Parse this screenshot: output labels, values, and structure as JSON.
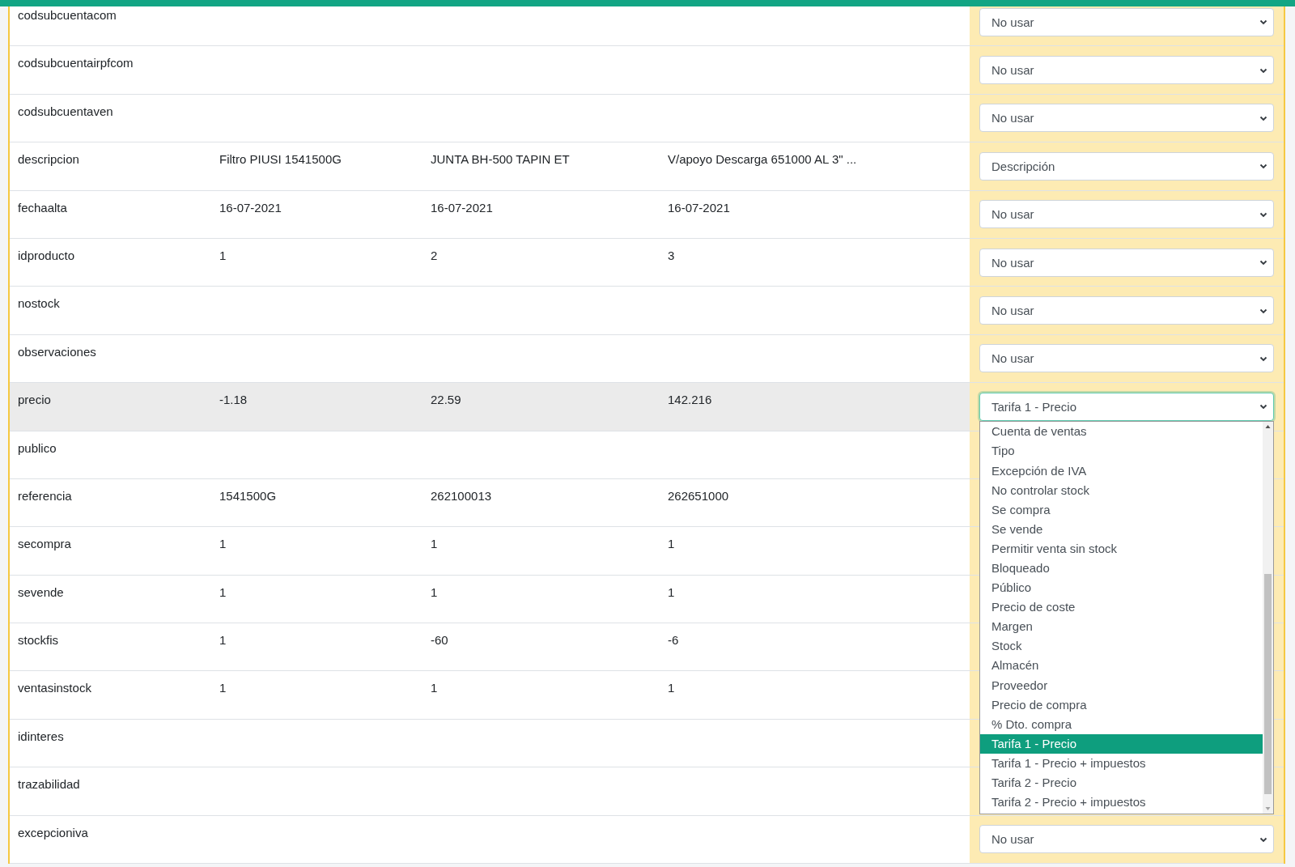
{
  "rows": [
    {
      "label": "codsubcuentacom",
      "highlighted": false,
      "mapping": {
        "value": "No usar",
        "focused": false
      }
    },
    {
      "label": "codsubcuentairpfcom",
      "highlighted": false,
      "mapping": {
        "value": "No usar",
        "focused": false
      }
    },
    {
      "label": "codsubcuentaven",
      "highlighted": false,
      "mapping": {
        "value": "No usar",
        "focused": false
      }
    },
    {
      "label": "descripcion",
      "highlighted": false,
      "values": [
        "Filtro PIUSI 1541500G",
        "JUNTA BH-500 TAPIN ET",
        "V/apoyo Descarga 651000 AL 3\" ..."
      ],
      "mapping": {
        "value": "Descripción",
        "focused": false
      }
    },
    {
      "label": "fechaalta",
      "highlighted": false,
      "values": [
        "16-07-2021",
        "16-07-2021",
        "16-07-2021"
      ],
      "mapping": {
        "value": "No usar",
        "focused": false
      }
    },
    {
      "label": "idproducto",
      "highlighted": false,
      "values": [
        "1",
        "2",
        "3"
      ],
      "mapping": {
        "value": "No usar",
        "focused": false
      }
    },
    {
      "label": "nostock",
      "highlighted": false,
      "mapping": {
        "value": "No usar",
        "focused": false
      }
    },
    {
      "label": "observaciones",
      "highlighted": false,
      "mapping": {
        "value": "No usar",
        "focused": false
      }
    },
    {
      "label": "precio",
      "highlighted": true,
      "values": [
        "-1.18",
        "22.59",
        "142.216"
      ],
      "mapping": {
        "value": "Tarifa 1 - Precio",
        "focused": true,
        "options": [
          {
            "label": "Cuenta de ventas",
            "selected": false
          },
          {
            "label": "Tipo",
            "selected": false
          },
          {
            "label": "Excepción de IVA",
            "selected": false
          },
          {
            "label": "No controlar stock",
            "selected": false
          },
          {
            "label": "Se compra",
            "selected": false
          },
          {
            "label": "Se vende",
            "selected": false
          },
          {
            "label": "Permitir venta sin stock",
            "selected": false
          },
          {
            "label": "Bloqueado",
            "selected": false
          },
          {
            "label": "Público",
            "selected": false
          },
          {
            "label": "Precio de coste",
            "selected": false
          },
          {
            "label": "Margen",
            "selected": false
          },
          {
            "label": "Stock",
            "selected": false
          },
          {
            "label": "Almacén",
            "selected": false
          },
          {
            "label": "Proveedor",
            "selected": false
          },
          {
            "label": "Precio de compra",
            "selected": false
          },
          {
            "label": "% Dto. compra",
            "selected": false
          },
          {
            "label": "Tarifa 1 - Precio",
            "selected": true
          },
          {
            "label": "Tarifa 1 - Precio + impuestos",
            "selected": false
          },
          {
            "label": "Tarifa 2 - Precio",
            "selected": false
          },
          {
            "label": "Tarifa 2 - Precio + impuestos",
            "selected": false
          }
        ]
      }
    },
    {
      "label": "publico",
      "highlighted": false
    },
    {
      "label": "referencia",
      "highlighted": false,
      "values": [
        "1541500G",
        "262100013",
        "262651000"
      ]
    },
    {
      "label": "secompra",
      "highlighted": false,
      "values": [
        "1",
        "1",
        "1"
      ]
    },
    {
      "label": "sevende",
      "highlighted": false,
      "values": [
        "1",
        "1",
        "1"
      ]
    },
    {
      "label": "stockfis",
      "highlighted": false,
      "values": [
        "1",
        "-60",
        "-6"
      ]
    },
    {
      "label": "ventasinstock",
      "highlighted": false,
      "values": [
        "1",
        "1",
        "1"
      ]
    },
    {
      "label": "idinteres",
      "highlighted": false
    },
    {
      "label": "trazabilidad",
      "highlighted": false
    },
    {
      "label": "excepcioniva",
      "highlighted": false,
      "mapping": {
        "value": "No usar",
        "focused": false
      }
    }
  ]
}
